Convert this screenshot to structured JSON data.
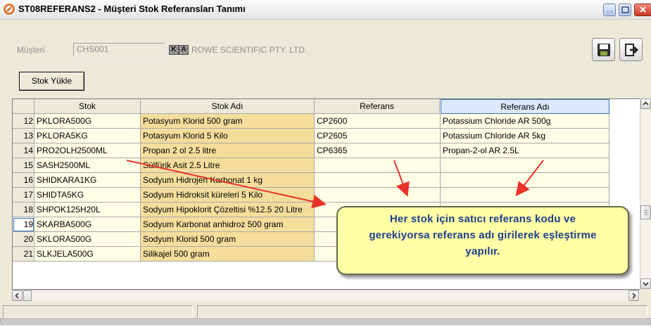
{
  "window": {
    "title": "ST08REFERANS2 - Müşteri Stok Referansları Tanımı"
  },
  "header": {
    "customer_label": "Müşteri",
    "customer_code": "CHS001",
    "badge_k": "K",
    "badge_a": "A",
    "customer_name": "ROWE SCIENTIFIC PTY. LTD.",
    "save_icon": "save-disk-icon",
    "exit_icon": "exit-door-icon"
  },
  "toolbar": {
    "stok_yukle_label": "Stok Yükle"
  },
  "grid": {
    "columns": [
      "Stok",
      "Stok Adı",
      "Referans",
      "Referans Adı"
    ],
    "active_column": "Referans Adı",
    "current_row": "19",
    "rows": [
      {
        "no": "12",
        "stok": "PKLORA500G",
        "stok_adi": "Potasyum Klorid 500 gram",
        "referans": "CP2600",
        "referans_adi": "Potassium Chloride AR  500g"
      },
      {
        "no": "13",
        "stok": "PKLORA5KG",
        "stok_adi": "Potasyum Klorid 5 Kilo",
        "referans": "CP2605",
        "referans_adi": "Potassium Chloride AR  5kg"
      },
      {
        "no": "14",
        "stok": "PRO2OLH2500ML",
        "stok_adi": "Propan 2 ol 2.5 litre",
        "referans": "CP6365",
        "referans_adi": "Propan-2-ol AR  2.5L"
      },
      {
        "no": "15",
        "stok": "SASH2500ML",
        "stok_adi": "Sülfürik Asit 2.5 Litre",
        "referans": "",
        "referans_adi": ""
      },
      {
        "no": "16",
        "stok": "SHIDKARA1KG",
        "stok_adi": "Sodyum Hidrojen Karbonat 1 kg",
        "referans": "",
        "referans_adi": ""
      },
      {
        "no": "17",
        "stok": "SHIDTA5KG",
        "stok_adi": "Sodyum Hidroksit küreleri 5 Kilo",
        "referans": "",
        "referans_adi": ""
      },
      {
        "no": "18",
        "stok": "SHPOK125H20L",
        "stok_adi": "Sodyum Hipoklorit Çözeltisi %12.5 20 Litre",
        "referans": "",
        "referans_adi": ""
      },
      {
        "no": "19",
        "stok": "SKARBA500G",
        "stok_adi": "Sodyum Karbonat anhidroz 500 gram",
        "referans": "",
        "referans_adi": ""
      },
      {
        "no": "20",
        "stok": "SKLORA500G",
        "stok_adi": "Sodyum Klorid 500 gram",
        "referans": "",
        "referans_adi": ""
      },
      {
        "no": "21",
        "stok": "SLKJELA500G",
        "stok_adi": "Silikajel 500 gram",
        "referans": "",
        "referans_adi": ""
      }
    ]
  },
  "annotation": {
    "line1": "Her stok için satıcı referans kodu ve",
    "line2": "gerekiyorsa referans adı girilerek eşleştirme",
    "line3": "yapılır.",
    "arrow_color": "#e8322a"
  },
  "colors": {
    "stok_adi_bg": "#f5dd9c",
    "row_bg": "#fefee6",
    "callout_bg": "#ffffa6",
    "callout_text": "#1f3f8c"
  }
}
